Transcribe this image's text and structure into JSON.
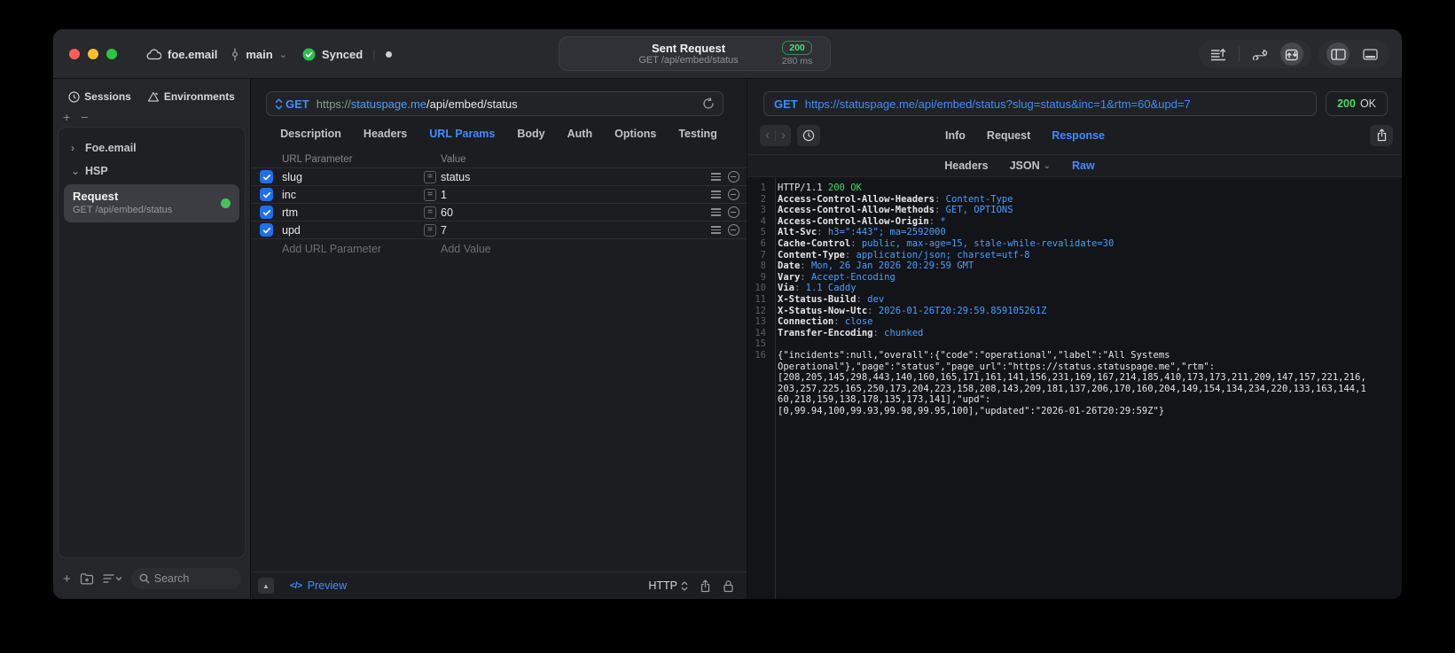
{
  "colors": {
    "accent_blue": "#3f8cff",
    "value_blue": "#4a9eff",
    "success_green": "#32d74b",
    "status_green": "#4dd964"
  },
  "icons": {
    "chevron_right": "›",
    "chevron_down": "⌄",
    "plus": "+",
    "minus": "−",
    "back": "‹",
    "forward": "›",
    "collapse": "▲",
    "code": "</>",
    "dot": "●",
    "stepper_up": "▲",
    "stepper_down": "▼"
  },
  "titlebar": {
    "project": "foe.email",
    "branch": "main",
    "sync": "Synced",
    "tab": {
      "title": "Sent Request",
      "subtitle": "GET /api/embed/status",
      "code": "200",
      "time": "280 ms"
    }
  },
  "sidebar": {
    "tabs": [
      {
        "label": "Sessions"
      },
      {
        "label": "Environments"
      }
    ],
    "groups": [
      {
        "label": "Foe.email",
        "expanded": false
      },
      {
        "label": "HSP",
        "expanded": true
      }
    ],
    "request": {
      "title": "Request",
      "subtitle": "GET /api/embed/status"
    },
    "search": {
      "placeholder": "Search"
    }
  },
  "editor": {
    "method": "GET",
    "url": {
      "scheme": "https://",
      "host": "statuspage.me",
      "path": "/api/embed/status"
    },
    "tabs": [
      "Description",
      "Headers",
      "URL Params",
      "Body",
      "Auth",
      "Options",
      "Testing"
    ],
    "active_tab": "URL Params",
    "params": {
      "columns": [
        "URL Parameter",
        "Value"
      ],
      "rows": [
        {
          "name": "slug",
          "value": "status",
          "enabled": true
        },
        {
          "name": "inc",
          "value": "1",
          "enabled": true
        },
        {
          "name": "rtm",
          "value": "60",
          "enabled": true
        },
        {
          "name": "upd",
          "value": "7",
          "enabled": true
        }
      ],
      "add_name": "Add URL Parameter",
      "add_value": "Add Value"
    },
    "footer": {
      "preview": "Preview",
      "protocol": "HTTP"
    }
  },
  "response": {
    "method": "GET",
    "url": "https://statuspage.me/api/embed/status?slug=status&inc=1&rtm=60&upd=7",
    "status_code": "200",
    "status_text": "OK",
    "tabs": [
      "Info",
      "Request",
      "Response"
    ],
    "active_tab": "Response",
    "subtabs": [
      "Headers",
      "JSON",
      "Raw"
    ],
    "active_subtab": "Raw",
    "lines": [
      {
        "n": "1",
        "parts": [
          [
            "t",
            "HTTP/1.1 "
          ],
          [
            "g",
            "200 OK"
          ]
        ]
      },
      {
        "n": "2",
        "parts": [
          [
            "h",
            "Access-Control-Allow-Headers"
          ],
          [
            "c",
            ": "
          ],
          [
            "v",
            "Content-Type"
          ]
        ]
      },
      {
        "n": "3",
        "parts": [
          [
            "h",
            "Access-Control-Allow-Methods"
          ],
          [
            "c",
            ": "
          ],
          [
            "v",
            "GET, OPTIONS"
          ]
        ]
      },
      {
        "n": "4",
        "parts": [
          [
            "h",
            "Access-Control-Allow-Origin"
          ],
          [
            "c",
            ": "
          ],
          [
            "v",
            "*"
          ]
        ]
      },
      {
        "n": "5",
        "parts": [
          [
            "h",
            "Alt-Svc"
          ],
          [
            "c",
            ": "
          ],
          [
            "v",
            "h3=\":443\"; ma=2592000"
          ]
        ]
      },
      {
        "n": "6",
        "parts": [
          [
            "h",
            "Cache-Control"
          ],
          [
            "c",
            ": "
          ],
          [
            "v",
            "public, max-age=15, stale-while-revalidate=30"
          ]
        ]
      },
      {
        "n": "7",
        "parts": [
          [
            "h",
            "Content-Type"
          ],
          [
            "c",
            ": "
          ],
          [
            "v",
            "application/json; charset=utf-8"
          ]
        ]
      },
      {
        "n": "8",
        "parts": [
          [
            "h",
            "Date"
          ],
          [
            "c",
            ": "
          ],
          [
            "v",
            "Mon, 26 Jan 2026 20:29:59 GMT"
          ]
        ]
      },
      {
        "n": "9",
        "parts": [
          [
            "h",
            "Vary"
          ],
          [
            "c",
            ": "
          ],
          [
            "v",
            "Accept-Encoding"
          ]
        ]
      },
      {
        "n": "10",
        "parts": [
          [
            "h",
            "Via"
          ],
          [
            "c",
            ": "
          ],
          [
            "v",
            "1.1 Caddy"
          ]
        ]
      },
      {
        "n": "11",
        "parts": [
          [
            "h",
            "X-Status-Build"
          ],
          [
            "c",
            ": "
          ],
          [
            "v",
            "dev"
          ]
        ]
      },
      {
        "n": "12",
        "parts": [
          [
            "h",
            "X-Status-Now-Utc"
          ],
          [
            "c",
            ": "
          ],
          [
            "v",
            "2026-01-26T20:29:59.859105261Z"
          ]
        ]
      },
      {
        "n": "13",
        "parts": [
          [
            "h",
            "Connection"
          ],
          [
            "c",
            ": "
          ],
          [
            "v",
            "close"
          ]
        ]
      },
      {
        "n": "14",
        "parts": [
          [
            "h",
            "Transfer-Encoding"
          ],
          [
            "c",
            ": "
          ],
          [
            "v",
            "chunked"
          ]
        ]
      },
      {
        "n": "15",
        "parts": []
      },
      {
        "n": "16",
        "parts": [
          [
            "t",
            "{\"incidents\":null,\"overall\":{\"code\":\"operational\",\"label\":\"All Systems"
          ]
        ]
      },
      {
        "n": "",
        "parts": [
          [
            "t",
            "Operational\"},\"page\":\"status\",\"page_url\":\"https://status.statuspage.me\",\"rtm\":"
          ]
        ]
      },
      {
        "n": "",
        "parts": [
          [
            "t",
            "[208,205,145,298,443,140,160,165,171,161,141,156,231,169,167,214,185,410,173,173,211,209,147,157,221,216,"
          ]
        ]
      },
      {
        "n": "",
        "parts": [
          [
            "t",
            "203,257,225,165,250,173,204,223,158,208,143,209,181,137,206,170,160,204,149,154,134,234,220,133,163,144,1"
          ]
        ]
      },
      {
        "n": "",
        "parts": [
          [
            "t",
            "60,218,159,138,178,135,173,141],\"upd\":"
          ]
        ]
      },
      {
        "n": "",
        "parts": [
          [
            "t",
            "[0,99.94,100,99.93,99.98,99.95,100],\"updated\":\"2026-01-26T20:29:59Z\"}"
          ]
        ]
      }
    ]
  }
}
